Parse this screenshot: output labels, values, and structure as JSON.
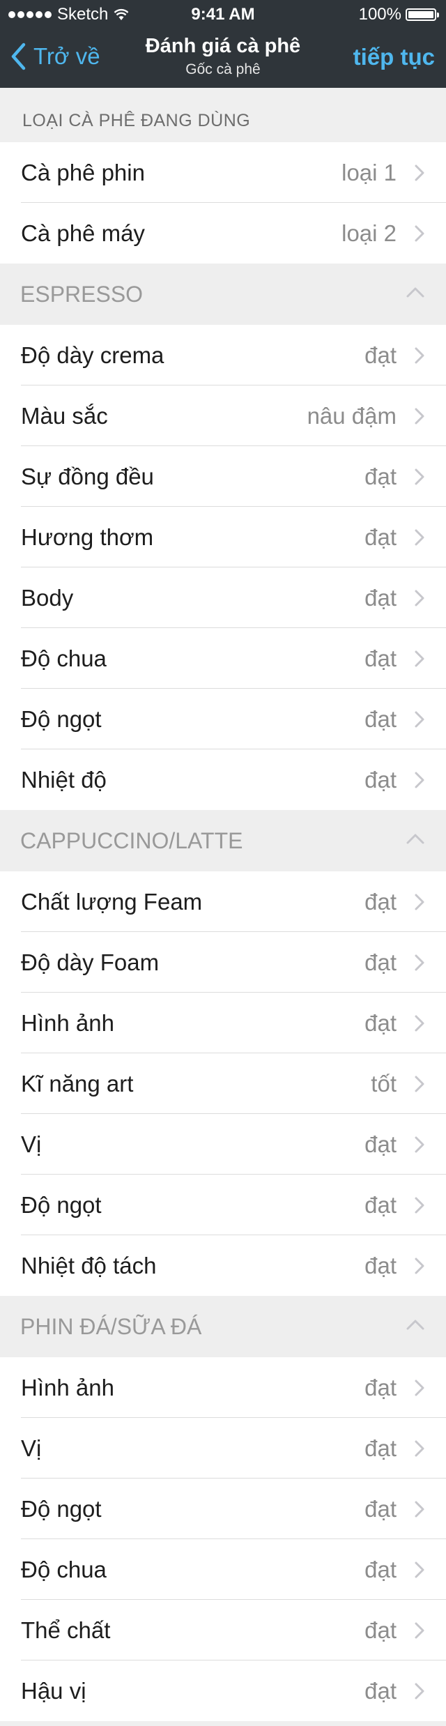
{
  "status_bar": {
    "carrier": "Sketch",
    "time": "9:41 AM",
    "battery": "100%",
    "battery_level": 1.0
  },
  "nav": {
    "back_label": "Trở về",
    "title": "Đánh giá cà phê",
    "subtitle": "Gốc cà phê",
    "next_label": "tiếp tục",
    "accent_color": "#4fb7ee",
    "bar_color": "#2f353a"
  },
  "coffee_types": {
    "header": "LOẠI CÀ PHÊ ĐANG DÙNG",
    "rows": [
      {
        "label": "Cà phê phin",
        "value": "loại 1"
      },
      {
        "label": "Cà phê máy",
        "value": "loại 2"
      }
    ]
  },
  "sections": [
    {
      "title": "ESPRESSO",
      "rows": [
        {
          "label": "Độ dày crema",
          "value": "đạt"
        },
        {
          "label": "Màu sắc",
          "value": "nâu đậm"
        },
        {
          "label": "Sự đồng đều",
          "value": "đạt"
        },
        {
          "label": "Hương thơm",
          "value": "đạt"
        },
        {
          "label": "Body",
          "value": "đạt"
        },
        {
          "label": "Độ chua",
          "value": "đạt"
        },
        {
          "label": "Độ ngọt",
          "value": "đạt"
        },
        {
          "label": "Nhiệt độ",
          "value": "đạt"
        }
      ]
    },
    {
      "title": "CAPPUCCINO/LATTE",
      "rows": [
        {
          "label": "Chất lượng Feam",
          "value": "đạt"
        },
        {
          "label": "Độ dày Foam",
          "value": "đạt"
        },
        {
          "label": "Hình ảnh",
          "value": "đạt"
        },
        {
          "label": "Kĩ năng art",
          "value": "tốt"
        },
        {
          "label": "Vị",
          "value": "đạt"
        },
        {
          "label": "Độ ngọt",
          "value": "đạt"
        },
        {
          "label": "Nhiệt độ tách",
          "value": "đạt"
        }
      ]
    },
    {
      "title": "PHIN ĐÁ/SỮA ĐÁ",
      "rows": [
        {
          "label": "Hình ảnh",
          "value": "đạt"
        },
        {
          "label": "Vị",
          "value": "đạt"
        },
        {
          "label": "Độ ngọt",
          "value": "đạt"
        },
        {
          "label": "Độ chua",
          "value": "đạt"
        },
        {
          "label": "Thể chất",
          "value": "đạt"
        },
        {
          "label": "Hậu vị",
          "value": "đạt"
        }
      ]
    }
  ]
}
